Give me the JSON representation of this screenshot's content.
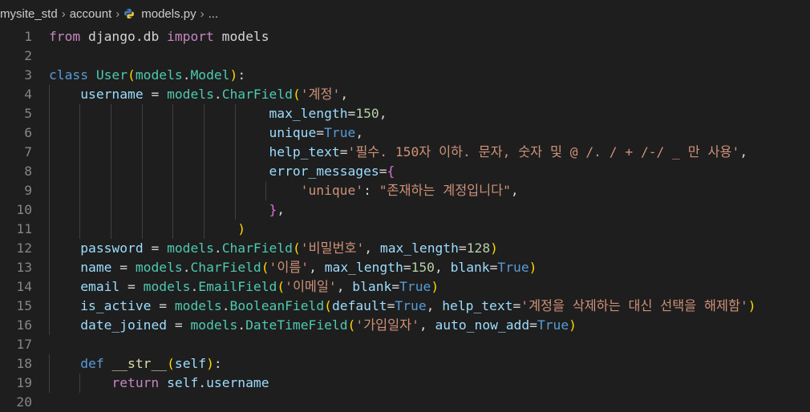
{
  "breadcrumb": {
    "project": "mysite_std",
    "folder": "account",
    "file": "models.py",
    "tail": "..."
  },
  "editor": {
    "language": "python",
    "lines": [
      {
        "n": "1",
        "tokens": [
          {
            "t": "from",
            "c": "kw2"
          },
          {
            "t": " django.db ",
            "c": "pl"
          },
          {
            "t": "import",
            "c": "kw2"
          },
          {
            "t": " models",
            "c": "pl"
          }
        ]
      },
      {
        "n": "2",
        "tokens": []
      },
      {
        "n": "3",
        "tokens": [
          {
            "t": "class",
            "c": "kw"
          },
          {
            "t": " ",
            "c": "pl"
          },
          {
            "t": "User",
            "c": "cls"
          },
          {
            "t": "(",
            "c": "b1"
          },
          {
            "t": "models",
            "c": "cls"
          },
          {
            "t": ".",
            "c": "pl"
          },
          {
            "t": "Model",
            "c": "cls"
          },
          {
            "t": ")",
            "c": "b1"
          },
          {
            "t": ":",
            "c": "pl"
          }
        ]
      },
      {
        "n": "4",
        "tokens": [
          {
            "t": "    ",
            "c": "pl"
          },
          {
            "t": "username",
            "c": "var"
          },
          {
            "t": " = ",
            "c": "pl"
          },
          {
            "t": "models",
            "c": "cls"
          },
          {
            "t": ".",
            "c": "pl"
          },
          {
            "t": "CharField",
            "c": "cls"
          },
          {
            "t": "(",
            "c": "b1"
          },
          {
            "t": "'계정'",
            "c": "str"
          },
          {
            "t": ",",
            "c": "pl"
          }
        ]
      },
      {
        "n": "5",
        "tokens": [
          {
            "t": "                            ",
            "c": "pl"
          },
          {
            "t": "max_length",
            "c": "var"
          },
          {
            "t": "=",
            "c": "pl"
          },
          {
            "t": "150",
            "c": "num"
          },
          {
            "t": ",",
            "c": "pl"
          }
        ]
      },
      {
        "n": "6",
        "tokens": [
          {
            "t": "                            ",
            "c": "pl"
          },
          {
            "t": "unique",
            "c": "var"
          },
          {
            "t": "=",
            "c": "pl"
          },
          {
            "t": "True",
            "c": "kw"
          },
          {
            "t": ",",
            "c": "pl"
          }
        ]
      },
      {
        "n": "7",
        "tokens": [
          {
            "t": "                            ",
            "c": "pl"
          },
          {
            "t": "help_text",
            "c": "var"
          },
          {
            "t": "=",
            "c": "pl"
          },
          {
            "t": "'필수. 150자 이하. 문자, 숫자 및 @ /. / + /-/ _ 만 사용'",
            "c": "str"
          },
          {
            "t": ",",
            "c": "pl"
          }
        ]
      },
      {
        "n": "8",
        "tokens": [
          {
            "t": "                            ",
            "c": "pl"
          },
          {
            "t": "error_messages",
            "c": "var"
          },
          {
            "t": "=",
            "c": "pl"
          },
          {
            "t": "{",
            "c": "b2"
          }
        ]
      },
      {
        "n": "9",
        "tokens": [
          {
            "t": "                                ",
            "c": "pl"
          },
          {
            "t": "'unique'",
            "c": "str"
          },
          {
            "t": ": ",
            "c": "pl"
          },
          {
            "t": "\"존재하는 계정입니다\"",
            "c": "str"
          },
          {
            "t": ",",
            "c": "pl"
          }
        ]
      },
      {
        "n": "10",
        "tokens": [
          {
            "t": "                            ",
            "c": "pl"
          },
          {
            "t": "}",
            "c": "b2"
          },
          {
            "t": ",",
            "c": "pl"
          }
        ]
      },
      {
        "n": "11",
        "tokens": [
          {
            "t": "                        ",
            "c": "pl"
          },
          {
            "t": ")",
            "c": "b1"
          }
        ]
      },
      {
        "n": "12",
        "tokens": [
          {
            "t": "    ",
            "c": "pl"
          },
          {
            "t": "password",
            "c": "var"
          },
          {
            "t": " = ",
            "c": "pl"
          },
          {
            "t": "models",
            "c": "cls"
          },
          {
            "t": ".",
            "c": "pl"
          },
          {
            "t": "CharField",
            "c": "cls"
          },
          {
            "t": "(",
            "c": "b1"
          },
          {
            "t": "'비밀번호'",
            "c": "str"
          },
          {
            "t": ", ",
            "c": "pl"
          },
          {
            "t": "max_length",
            "c": "var"
          },
          {
            "t": "=",
            "c": "pl"
          },
          {
            "t": "128",
            "c": "num"
          },
          {
            "t": ")",
            "c": "b1"
          }
        ]
      },
      {
        "n": "13",
        "tokens": [
          {
            "t": "    ",
            "c": "pl"
          },
          {
            "t": "name",
            "c": "var"
          },
          {
            "t": " = ",
            "c": "pl"
          },
          {
            "t": "models",
            "c": "cls"
          },
          {
            "t": ".",
            "c": "pl"
          },
          {
            "t": "CharField",
            "c": "cls"
          },
          {
            "t": "(",
            "c": "b1"
          },
          {
            "t": "'이름'",
            "c": "str"
          },
          {
            "t": ", ",
            "c": "pl"
          },
          {
            "t": "max_length",
            "c": "var"
          },
          {
            "t": "=",
            "c": "pl"
          },
          {
            "t": "150",
            "c": "num"
          },
          {
            "t": ", ",
            "c": "pl"
          },
          {
            "t": "blank",
            "c": "var"
          },
          {
            "t": "=",
            "c": "pl"
          },
          {
            "t": "True",
            "c": "kw"
          },
          {
            "t": ")",
            "c": "b1"
          }
        ]
      },
      {
        "n": "14",
        "tokens": [
          {
            "t": "    ",
            "c": "pl"
          },
          {
            "t": "email",
            "c": "var"
          },
          {
            "t": " = ",
            "c": "pl"
          },
          {
            "t": "models",
            "c": "cls"
          },
          {
            "t": ".",
            "c": "pl"
          },
          {
            "t": "EmailField",
            "c": "cls"
          },
          {
            "t": "(",
            "c": "b1"
          },
          {
            "t": "'이메일'",
            "c": "str"
          },
          {
            "t": ", ",
            "c": "pl"
          },
          {
            "t": "blank",
            "c": "var"
          },
          {
            "t": "=",
            "c": "pl"
          },
          {
            "t": "True",
            "c": "kw"
          },
          {
            "t": ")",
            "c": "b1"
          }
        ]
      },
      {
        "n": "15",
        "tokens": [
          {
            "t": "    ",
            "c": "pl"
          },
          {
            "t": "is_active",
            "c": "var"
          },
          {
            "t": " = ",
            "c": "pl"
          },
          {
            "t": "models",
            "c": "cls"
          },
          {
            "t": ".",
            "c": "pl"
          },
          {
            "t": "BooleanField",
            "c": "cls"
          },
          {
            "t": "(",
            "c": "b1"
          },
          {
            "t": "default",
            "c": "var"
          },
          {
            "t": "=",
            "c": "pl"
          },
          {
            "t": "True",
            "c": "kw"
          },
          {
            "t": ", ",
            "c": "pl"
          },
          {
            "t": "help_text",
            "c": "var"
          },
          {
            "t": "=",
            "c": "pl"
          },
          {
            "t": "'계정을 삭제하는 대신 선택을 해제함'",
            "c": "str"
          },
          {
            "t": ")",
            "c": "b1"
          }
        ]
      },
      {
        "n": "16",
        "tokens": [
          {
            "t": "    ",
            "c": "pl"
          },
          {
            "t": "date_joined",
            "c": "var"
          },
          {
            "t": " = ",
            "c": "pl"
          },
          {
            "t": "models",
            "c": "cls"
          },
          {
            "t": ".",
            "c": "pl"
          },
          {
            "t": "DateTimeField",
            "c": "cls"
          },
          {
            "t": "(",
            "c": "b1"
          },
          {
            "t": "'가입일자'",
            "c": "str"
          },
          {
            "t": ", ",
            "c": "pl"
          },
          {
            "t": "auto_now_add",
            "c": "var"
          },
          {
            "t": "=",
            "c": "pl"
          },
          {
            "t": "True",
            "c": "kw"
          },
          {
            "t": ")",
            "c": "b1"
          }
        ]
      },
      {
        "n": "17",
        "tokens": []
      },
      {
        "n": "18",
        "tokens": [
          {
            "t": "    ",
            "c": "pl"
          },
          {
            "t": "def",
            "c": "kw"
          },
          {
            "t": " ",
            "c": "pl"
          },
          {
            "t": "__str__",
            "c": "fn"
          },
          {
            "t": "(",
            "c": "b1"
          },
          {
            "t": "self",
            "c": "var"
          },
          {
            "t": ")",
            "c": "b1"
          },
          {
            "t": ":",
            "c": "pl"
          }
        ]
      },
      {
        "n": "19",
        "tokens": [
          {
            "t": "        ",
            "c": "pl"
          },
          {
            "t": "return",
            "c": "kw2"
          },
          {
            "t": " ",
            "c": "pl"
          },
          {
            "t": "self",
            "c": "var"
          },
          {
            "t": ".",
            "c": "pl"
          },
          {
            "t": "username",
            "c": "var"
          }
        ]
      },
      {
        "n": "20",
        "tokens": []
      }
    ]
  },
  "colors": {
    "background": "#1e1e1e",
    "line_number": "#858585",
    "keyword": "#569cd6",
    "control_keyword": "#c586c0",
    "class": "#4ec9b0",
    "variable": "#9cdcfe",
    "function": "#dcdcaa",
    "string": "#ce9178",
    "number": "#b5cea8",
    "bracket_1": "#ffd700",
    "bracket_2": "#da70d6"
  },
  "icons": {
    "file_icon": "python-icon"
  }
}
